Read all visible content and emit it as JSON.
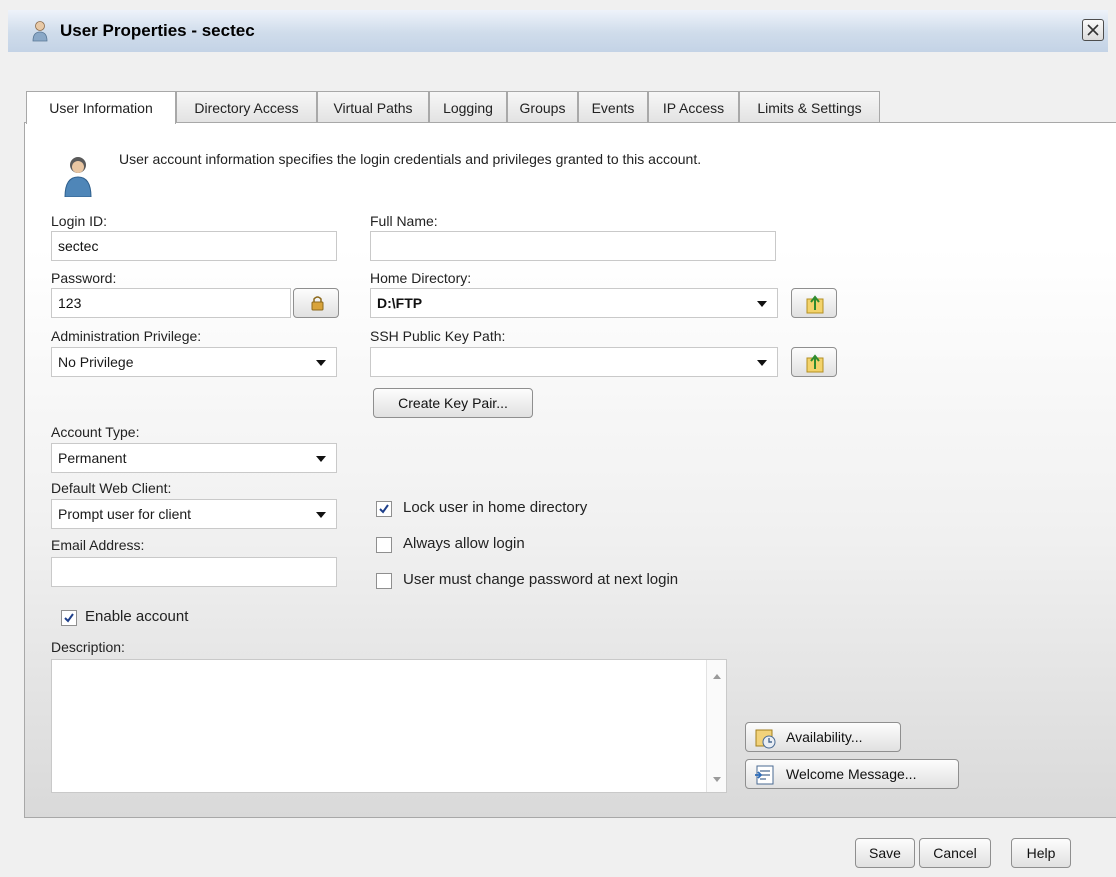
{
  "window": {
    "title": "User Properties - sectec"
  },
  "tabs": [
    {
      "label": "User Information"
    },
    {
      "label": "Directory Access"
    },
    {
      "label": "Virtual Paths"
    },
    {
      "label": "Logging"
    },
    {
      "label": "Groups"
    },
    {
      "label": "Events"
    },
    {
      "label": "IP Access"
    },
    {
      "label": "Limits & Settings"
    }
  ],
  "info": {
    "text": "User account information specifies the login credentials and privileges granted to this account."
  },
  "form": {
    "login_id": {
      "label": "Login ID:",
      "value": "sectec"
    },
    "full_name": {
      "label": "Full Name:",
      "value": ""
    },
    "password": {
      "label": "Password:",
      "value": "123"
    },
    "home_dir": {
      "label": "Home Directory:",
      "value": "D:\\FTP"
    },
    "admin_priv": {
      "label": "Administration Privilege:",
      "value": "No Privilege"
    },
    "ssh_key": {
      "label": "SSH Public Key Path:",
      "value": ""
    },
    "create_key_pair": "Create Key Pair...",
    "account_type": {
      "label": "Account Type:",
      "value": "Permanent"
    },
    "web_client": {
      "label": "Default Web Client:",
      "value": "Prompt user for client"
    },
    "email": {
      "label": "Email Address:",
      "value": ""
    },
    "lock_home": {
      "label": "Lock user in home directory",
      "checked": true
    },
    "always_allow": {
      "label": "Always allow login",
      "checked": false
    },
    "must_change": {
      "label": "User must change password at next login",
      "checked": false
    },
    "enable_account": {
      "label": "Enable account",
      "checked": true
    },
    "description": {
      "label": "Description:",
      "value": ""
    },
    "availability": "Availability...",
    "welcome": "Welcome Message..."
  },
  "footer": {
    "save": "Save",
    "cancel": "Cancel",
    "help": "Help"
  }
}
